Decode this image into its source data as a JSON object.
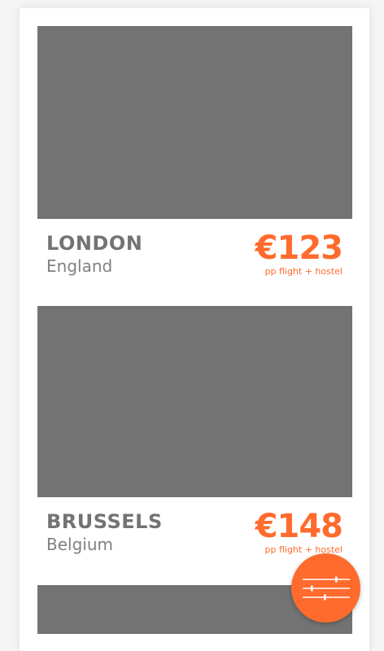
{
  "colors": {
    "accent": "#ff6b2d",
    "image_placeholder": "#737373",
    "city_text": "#737373",
    "country_text": "#808080"
  },
  "destinations": [
    {
      "city": "LONDON",
      "country": "England",
      "price": "€123",
      "price_note": "pp flight + hostel"
    },
    {
      "city": "BRUSSELS",
      "country": "Belgium",
      "price": "€148",
      "price_note": "pp flight + hostel"
    }
  ],
  "filter_button": {
    "icon": "sliders-icon"
  }
}
